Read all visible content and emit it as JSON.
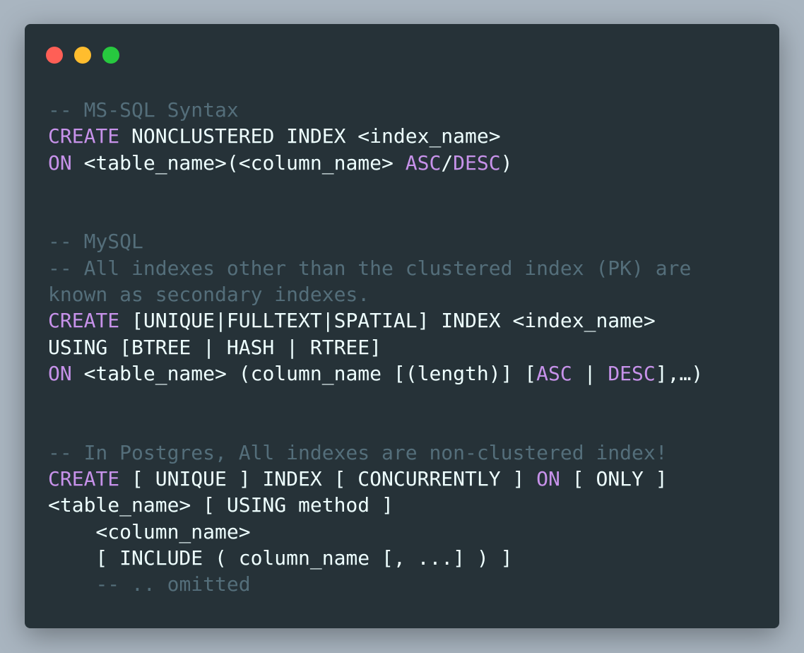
{
  "window_controls": [
    {
      "name": "close",
      "color": "#ff5f56"
    },
    {
      "name": "minimize",
      "color": "#ffbd2e"
    },
    {
      "name": "maximize",
      "color": "#27c93f"
    }
  ],
  "colors": {
    "background": "#263238",
    "comment": "#546e7a",
    "keyword": "#c792ea",
    "text": "#eeffff"
  },
  "code_lines": [
    [
      [
        "comment",
        "-- MS-SQL Syntax"
      ]
    ],
    [
      [
        "keyword",
        "CREATE"
      ],
      [
        "text",
        " NONCLUSTERED INDEX <index_name>"
      ]
    ],
    [
      [
        "keyword",
        "ON"
      ],
      [
        "text",
        " <table_name>(<column_name> "
      ],
      [
        "keyword",
        "ASC"
      ],
      [
        "text",
        "/"
      ],
      [
        "keyword",
        "DESC"
      ],
      [
        "text",
        ")"
      ]
    ],
    [],
    [],
    [
      [
        "comment",
        "-- MySQL"
      ]
    ],
    [
      [
        "comment",
        "-- All indexes other than the clustered index (PK) are"
      ]
    ],
    [
      [
        "comment",
        "known as secondary indexes."
      ]
    ],
    [
      [
        "keyword",
        "CREATE"
      ],
      [
        "text",
        " [UNIQUE|FULLTEXT|SPATIAL] INDEX <index_name>"
      ]
    ],
    [
      [
        "text",
        "USING [BTREE | HASH | RTREE]"
      ]
    ],
    [
      [
        "keyword",
        "ON"
      ],
      [
        "text",
        " <table_name> (column_name [(length)] ["
      ],
      [
        "keyword",
        "ASC"
      ],
      [
        "text",
        " | "
      ],
      [
        "keyword",
        "DESC"
      ],
      [
        "text",
        "],…)"
      ]
    ],
    [],
    [],
    [
      [
        "comment",
        "-- In Postgres, All indexes are non-clustered index!"
      ]
    ],
    [
      [
        "keyword",
        "CREATE"
      ],
      [
        "text",
        " [ UNIQUE ] INDEX [ CONCURRENTLY ] "
      ],
      [
        "keyword",
        "ON"
      ],
      [
        "text",
        " [ ONLY ]"
      ]
    ],
    [
      [
        "text",
        "<table_name> [ USING method ]"
      ]
    ],
    [
      [
        "text",
        "    <column_name>"
      ]
    ],
    [
      [
        "text",
        "    [ INCLUDE ( column_name [, ...] ) ]"
      ]
    ],
    [
      [
        "text",
        "    "
      ],
      [
        "comment",
        "-- .. omitted"
      ]
    ]
  ]
}
